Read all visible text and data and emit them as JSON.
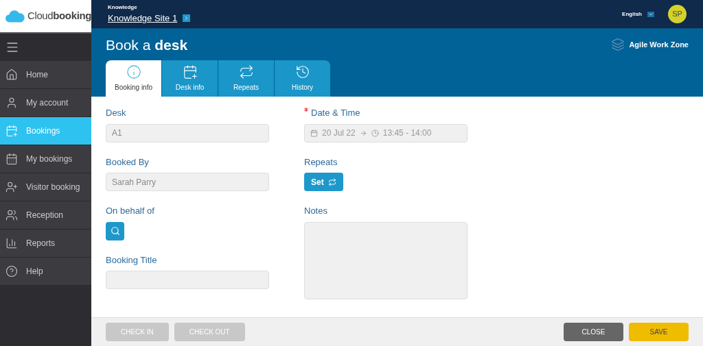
{
  "logo": {
    "light": "Cloud",
    "bold": "booking"
  },
  "topbar": {
    "breadcrumb": "Knowledge",
    "site": "Knowledge Site 1",
    "language": "English",
    "avatar": "SP"
  },
  "sidebar": {
    "items": [
      {
        "label": "Home",
        "selected": false
      },
      {
        "label": "My account",
        "selected": false
      },
      {
        "label": "Bookings",
        "selected": true
      },
      {
        "label": "My bookings",
        "selected": false
      },
      {
        "label": "Visitor booking",
        "selected": false
      },
      {
        "label": "Reception",
        "selected": false
      },
      {
        "label": "Reports",
        "selected": false
      },
      {
        "label": "Help",
        "selected": false
      }
    ]
  },
  "header": {
    "title": "Book a **desk**",
    "zone": "Agile Work Zone"
  },
  "tabs": [
    {
      "label": "Booking info",
      "selected": true
    },
    {
      "label": "Desk info",
      "selected": false
    },
    {
      "label": "Repeats",
      "selected": false
    },
    {
      "label": "History",
      "selected": false
    }
  ],
  "form": {
    "left": [
      {
        "kind": "text",
        "label": "Desk",
        "value": "A1"
      },
      {
        "kind": "text",
        "label": "Booked By",
        "value": "Sarah Parry"
      },
      {
        "kind": "search",
        "label": "On behalf of"
      },
      {
        "kind": "text",
        "label": "Booking Title"
      }
    ],
    "right": [
      {
        "kind": "datetime",
        "label": "Date & Time",
        "date": "20 Jul 22",
        "time": "13:45 - 14:00",
        "required": true
      },
      {
        "kind": "repeat",
        "label": "Repeats",
        "button": "Set"
      },
      {
        "kind": "textarea",
        "label": "Notes"
      }
    ]
  },
  "footer": {
    "left": [
      {
        "label": "CHECK IN",
        "disabled": true
      },
      {
        "label": "CHECK OUT",
        "disabled": true
      }
    ],
    "right": [
      {
        "label": "CLOSE",
        "kind": "close"
      },
      {
        "label": "SAVE",
        "kind": "save"
      }
    ]
  }
}
